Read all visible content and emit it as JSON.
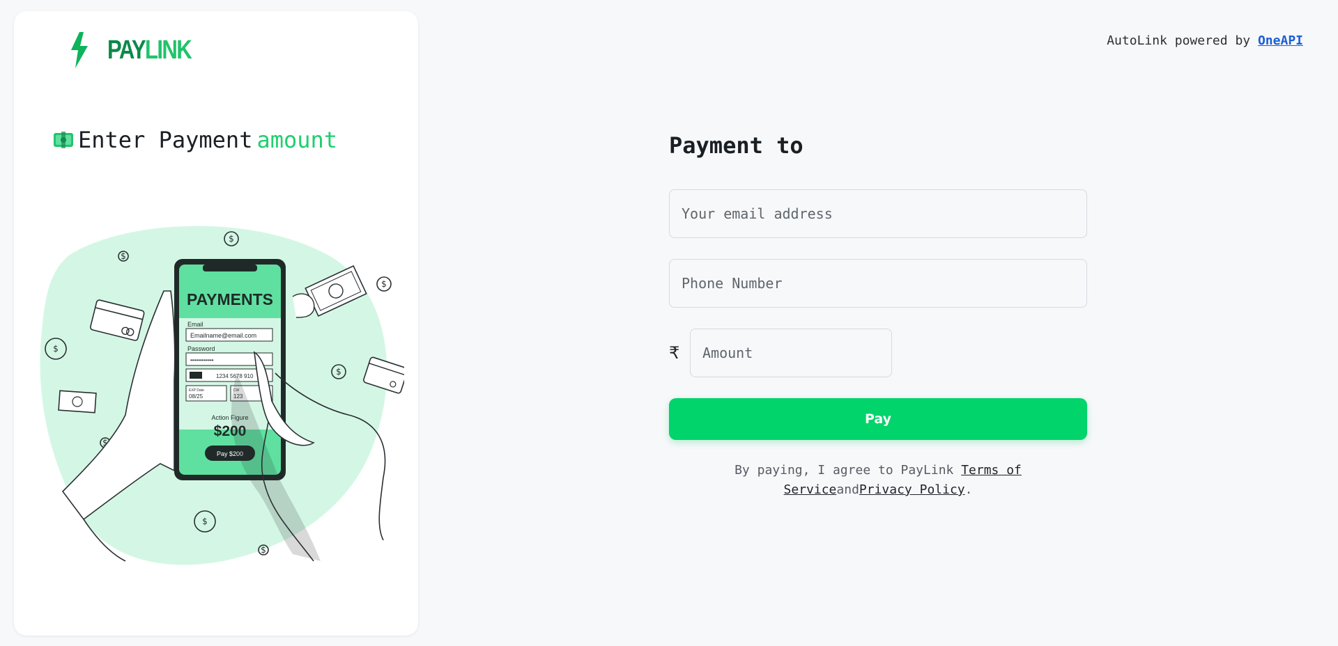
{
  "brand": {
    "pay": "PAY",
    "link": "LINK"
  },
  "left": {
    "headline_prefix": "Enter Payment",
    "headline_accent": "amount",
    "phone": {
      "title": "PAYMENTS",
      "email_label": "Email",
      "email_value": "Emailname@email.com",
      "password_label": "Password",
      "password_value": "••••••••••••",
      "card_number": "1234 5678 910",
      "exp_label": "EXP Date",
      "exp_value": "08/25",
      "cvv_label": "CW",
      "cvv_value": "123",
      "item_label": "Action Figure",
      "item_price": "$200",
      "pay_button": "Pay $200"
    }
  },
  "header": {
    "powered_text": "AutoLink powered by",
    "powered_link": "OneAPI"
  },
  "form": {
    "title": "Payment to",
    "email_placeholder": "Your email address",
    "phone_placeholder": "Phone Number",
    "currency_symbol": "₹",
    "amount_placeholder": "Amount",
    "pay_label": "Pay",
    "terms_prefix": "By paying, I agree to PayLink ",
    "terms_link": "Terms of Service",
    "terms_and": "and",
    "privacy_link": "Privacy Policy",
    "terms_suffix": "."
  },
  "colors": {
    "accent": "#00d46a",
    "brand_dark": "#0b8a4a",
    "link": "#1b5fd6",
    "illustration_fill": "#d4f7e5",
    "phone_green": "#5fe0a0"
  }
}
